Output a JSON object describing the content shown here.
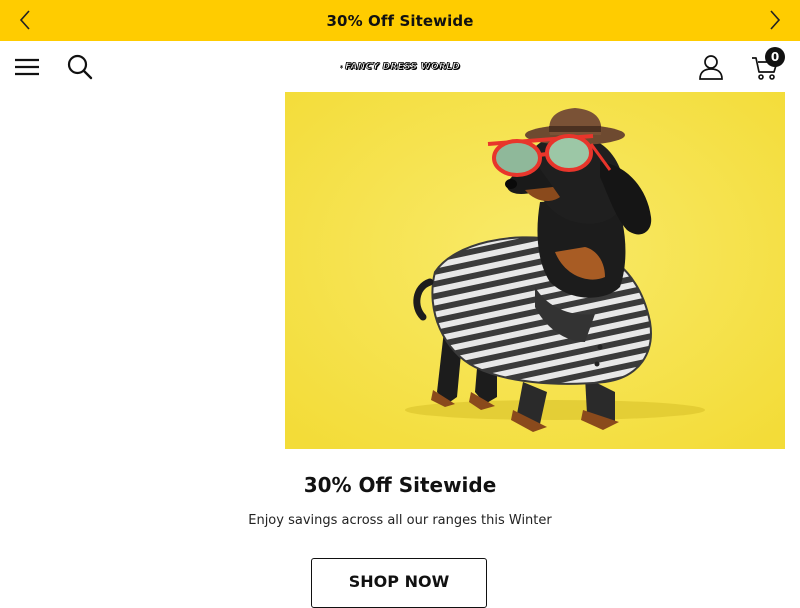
{
  "promo_bar": {
    "text": "30% Off Sitewide",
    "prev_icon": "chevron-left-icon",
    "next_icon": "chevron-right-icon",
    "background_color": "#ffcc00"
  },
  "header": {
    "menu_icon": "hamburger-menu-icon",
    "search_icon": "search-icon",
    "logo_text": "FANCY DRESS WORLD",
    "account_icon": "user-icon",
    "cart_icon": "cart-icon",
    "cart_count": "0"
  },
  "hero": {
    "image_description": "dachshund-in-striped-shirt-hat-sunglasses",
    "background_color": "#f6e346",
    "title": "30% Off Sitewide",
    "subtitle": "Enjoy savings across all our ranges this Winter",
    "cta_label": "SHOP NOW"
  }
}
